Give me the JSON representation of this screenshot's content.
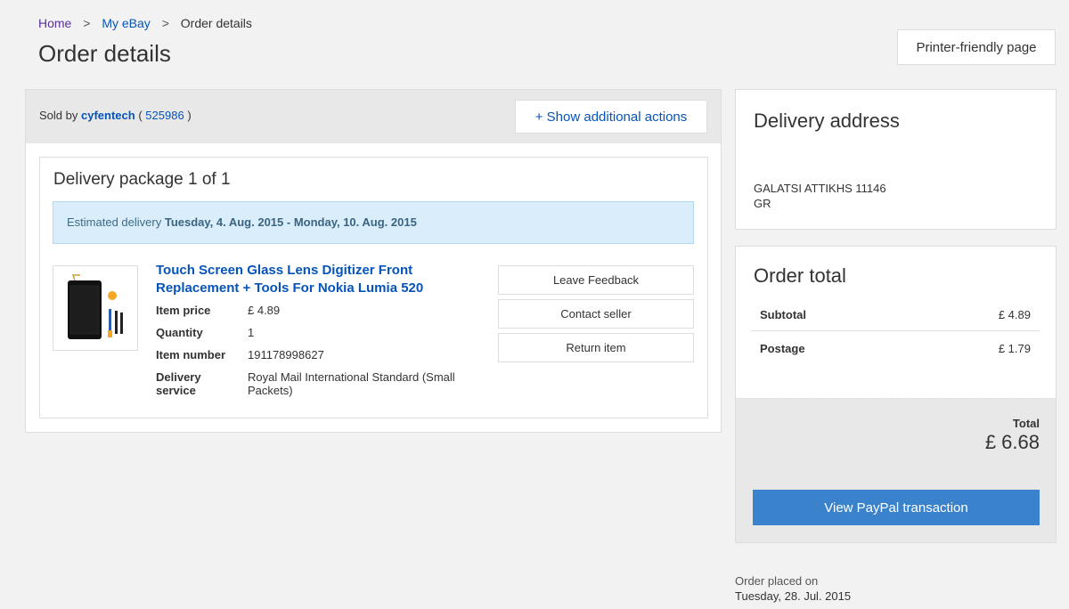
{
  "breadcrumb": {
    "home": "Home",
    "sep1": ">",
    "myebay": "My eBay",
    "sep2": ">",
    "current": "Order details"
  },
  "page_title": "Order details",
  "printer_button": "Printer-friendly page",
  "seller": {
    "prefix": "Sold by",
    "name": "cyfentech",
    "open_paren": "(",
    "score": "525986",
    "close_paren": ")",
    "actions_button": "+ Show additional actions"
  },
  "package": {
    "title": "Delivery package 1 of 1",
    "estimate_prefix": "Estimated delivery",
    "estimate_dates": "Tuesday, 4. Aug. 2015 - Monday, 10. Aug. 2015"
  },
  "item": {
    "title": "Touch Screen Glass Lens Digitizer Front Replacement + Tools For Nokia Lumia 520",
    "specs": [
      {
        "label": "Item price",
        "value": "£ 4.89"
      },
      {
        "label": "Quantity",
        "value": "1"
      },
      {
        "label": "Item number",
        "value": "191178998627"
      },
      {
        "label": "Delivery service",
        "value": "Royal Mail International Standard (Small Packets)"
      }
    ]
  },
  "item_actions": {
    "feedback": "Leave Feedback",
    "contact": "Contact seller",
    "return": "Return item"
  },
  "address": {
    "heading": "Delivery address",
    "line1": "GALATSI ATTIKHS 11146",
    "line2": "GR"
  },
  "totals": {
    "heading": "Order total",
    "subtotal_label": "Subtotal",
    "subtotal_value": "£ 4.89",
    "postage_label": "Postage",
    "postage_value": "£ 1.79",
    "total_label": "Total",
    "total_value": "£ 6.68",
    "paypal_button": "View PayPal transaction"
  },
  "order_placed": {
    "label": "Order placed on",
    "date": "Tuesday, 28. Jul. 2015"
  },
  "colors": {
    "link": "#0654ba",
    "paypal_button": "#3b82cc",
    "estimate_bg": "#d9eefa",
    "page_bg": "#f2f2f2"
  },
  "icons": {
    "product_thumbnail": "phone-digitizer-with-tools-image"
  }
}
